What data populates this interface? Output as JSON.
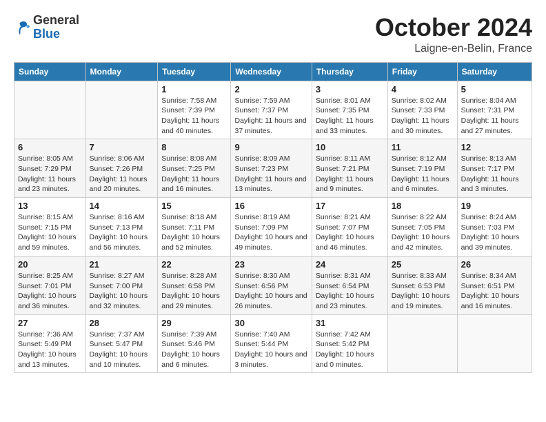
{
  "header": {
    "logo": {
      "line1": "General",
      "line2": "Blue"
    },
    "title": "October 2024",
    "location": "Laigne-en-Belin, France"
  },
  "days_of_week": [
    "Sunday",
    "Monday",
    "Tuesday",
    "Wednesday",
    "Thursday",
    "Friday",
    "Saturday"
  ],
  "weeks": [
    [
      {
        "day": "",
        "detail": ""
      },
      {
        "day": "",
        "detail": ""
      },
      {
        "day": "1",
        "detail": "Sunrise: 7:58 AM\nSunset: 7:39 PM\nDaylight: 11 hours and 40 minutes."
      },
      {
        "day": "2",
        "detail": "Sunrise: 7:59 AM\nSunset: 7:37 PM\nDaylight: 11 hours and 37 minutes."
      },
      {
        "day": "3",
        "detail": "Sunrise: 8:01 AM\nSunset: 7:35 PM\nDaylight: 11 hours and 33 minutes."
      },
      {
        "day": "4",
        "detail": "Sunrise: 8:02 AM\nSunset: 7:33 PM\nDaylight: 11 hours and 30 minutes."
      },
      {
        "day": "5",
        "detail": "Sunrise: 8:04 AM\nSunset: 7:31 PM\nDaylight: 11 hours and 27 minutes."
      }
    ],
    [
      {
        "day": "6",
        "detail": "Sunrise: 8:05 AM\nSunset: 7:29 PM\nDaylight: 11 hours and 23 minutes."
      },
      {
        "day": "7",
        "detail": "Sunrise: 8:06 AM\nSunset: 7:26 PM\nDaylight: 11 hours and 20 minutes."
      },
      {
        "day": "8",
        "detail": "Sunrise: 8:08 AM\nSunset: 7:25 PM\nDaylight: 11 hours and 16 minutes."
      },
      {
        "day": "9",
        "detail": "Sunrise: 8:09 AM\nSunset: 7:23 PM\nDaylight: 11 hours and 13 minutes."
      },
      {
        "day": "10",
        "detail": "Sunrise: 8:11 AM\nSunset: 7:21 PM\nDaylight: 11 hours and 9 minutes."
      },
      {
        "day": "11",
        "detail": "Sunrise: 8:12 AM\nSunset: 7:19 PM\nDaylight: 11 hours and 6 minutes."
      },
      {
        "day": "12",
        "detail": "Sunrise: 8:13 AM\nSunset: 7:17 PM\nDaylight: 11 hours and 3 minutes."
      }
    ],
    [
      {
        "day": "13",
        "detail": "Sunrise: 8:15 AM\nSunset: 7:15 PM\nDaylight: 10 hours and 59 minutes."
      },
      {
        "day": "14",
        "detail": "Sunrise: 8:16 AM\nSunset: 7:13 PM\nDaylight: 10 hours and 56 minutes."
      },
      {
        "day": "15",
        "detail": "Sunrise: 8:18 AM\nSunset: 7:11 PM\nDaylight: 10 hours and 52 minutes."
      },
      {
        "day": "16",
        "detail": "Sunrise: 8:19 AM\nSunset: 7:09 PM\nDaylight: 10 hours and 49 minutes."
      },
      {
        "day": "17",
        "detail": "Sunrise: 8:21 AM\nSunset: 7:07 PM\nDaylight: 10 hours and 46 minutes."
      },
      {
        "day": "18",
        "detail": "Sunrise: 8:22 AM\nSunset: 7:05 PM\nDaylight: 10 hours and 42 minutes."
      },
      {
        "day": "19",
        "detail": "Sunrise: 8:24 AM\nSunset: 7:03 PM\nDaylight: 10 hours and 39 minutes."
      }
    ],
    [
      {
        "day": "20",
        "detail": "Sunrise: 8:25 AM\nSunset: 7:01 PM\nDaylight: 10 hours and 36 minutes."
      },
      {
        "day": "21",
        "detail": "Sunrise: 8:27 AM\nSunset: 7:00 PM\nDaylight: 10 hours and 32 minutes."
      },
      {
        "day": "22",
        "detail": "Sunrise: 8:28 AM\nSunset: 6:58 PM\nDaylight: 10 hours and 29 minutes."
      },
      {
        "day": "23",
        "detail": "Sunrise: 8:30 AM\nSunset: 6:56 PM\nDaylight: 10 hours and 26 minutes."
      },
      {
        "day": "24",
        "detail": "Sunrise: 8:31 AM\nSunset: 6:54 PM\nDaylight: 10 hours and 23 minutes."
      },
      {
        "day": "25",
        "detail": "Sunrise: 8:33 AM\nSunset: 6:53 PM\nDaylight: 10 hours and 19 minutes."
      },
      {
        "day": "26",
        "detail": "Sunrise: 8:34 AM\nSunset: 6:51 PM\nDaylight: 10 hours and 16 minutes."
      }
    ],
    [
      {
        "day": "27",
        "detail": "Sunrise: 7:36 AM\nSunset: 5:49 PM\nDaylight: 10 hours and 13 minutes."
      },
      {
        "day": "28",
        "detail": "Sunrise: 7:37 AM\nSunset: 5:47 PM\nDaylight: 10 hours and 10 minutes."
      },
      {
        "day": "29",
        "detail": "Sunrise: 7:39 AM\nSunset: 5:46 PM\nDaylight: 10 hours and 6 minutes."
      },
      {
        "day": "30",
        "detail": "Sunrise: 7:40 AM\nSunset: 5:44 PM\nDaylight: 10 hours and 3 minutes."
      },
      {
        "day": "31",
        "detail": "Sunrise: 7:42 AM\nSunset: 5:42 PM\nDaylight: 10 hours and 0 minutes."
      },
      {
        "day": "",
        "detail": ""
      },
      {
        "day": "",
        "detail": ""
      }
    ]
  ]
}
